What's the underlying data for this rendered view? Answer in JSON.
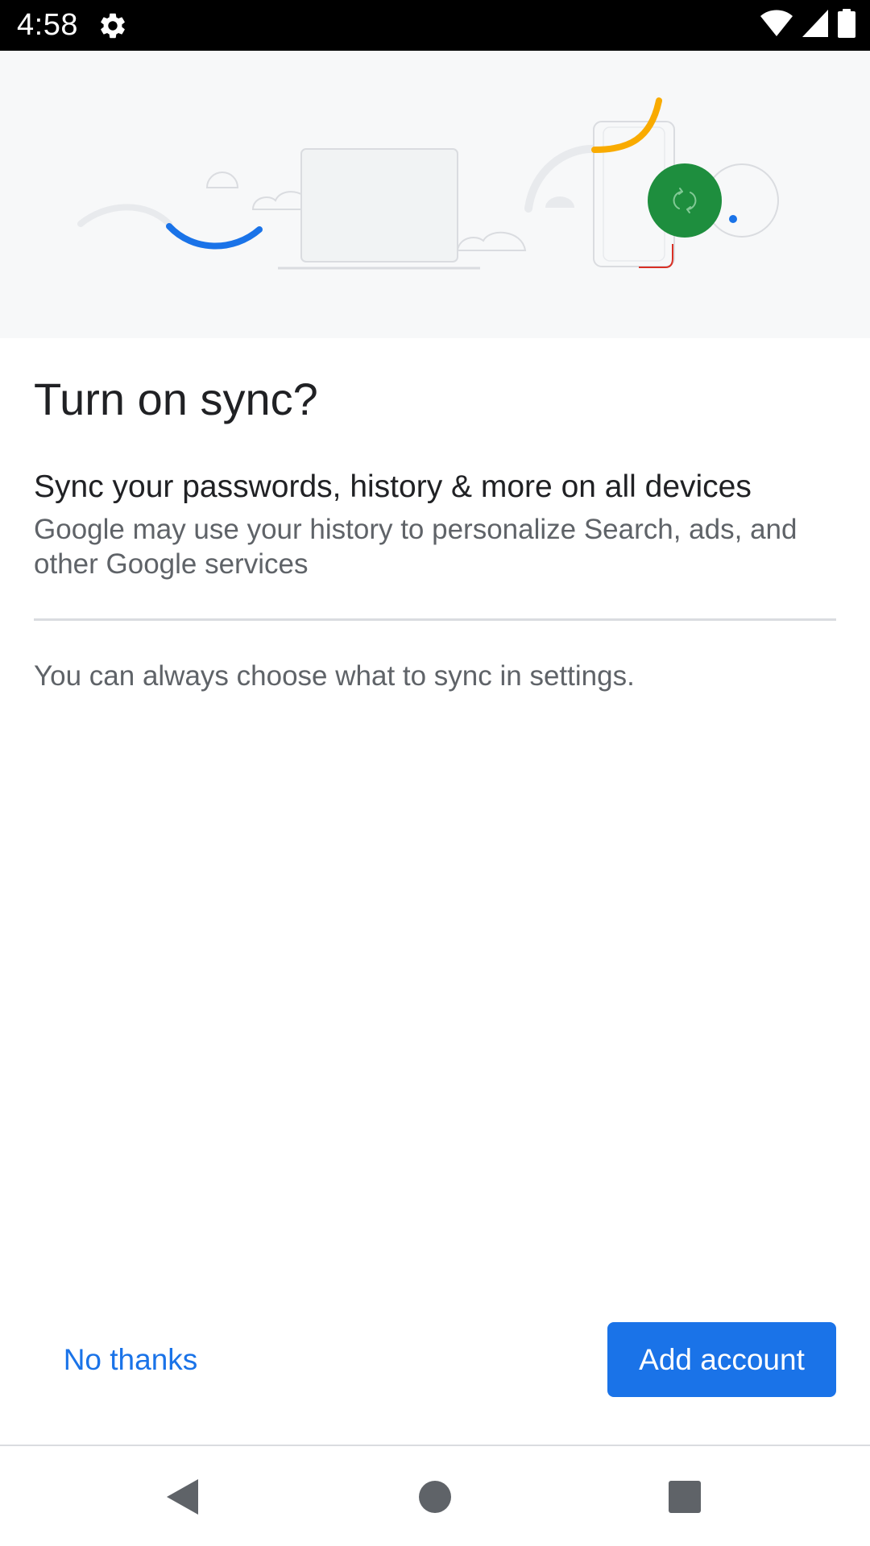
{
  "status_bar": {
    "time": "4:58",
    "icons": [
      "settings-gear-icon",
      "wifi-icon",
      "cell-signal-icon",
      "battery-icon"
    ]
  },
  "hero": {
    "illustration": "sync-devices-illustration",
    "colors": {
      "background": "#f7f8f9",
      "blue_arc": "#1a73e8",
      "yellow_arc": "#f9ab00",
      "green_circle": "#1e8e3e",
      "red_accent": "#d93025",
      "outline": "#dadce0"
    }
  },
  "dialog": {
    "title": "Turn on sync?",
    "subtitle": "Sync your passwords, history & more on all devices",
    "description": "Google may use your history to personalize Search, ads, and other Google services",
    "settings_note": "You can always choose what to sync in settings."
  },
  "actions": {
    "no_thanks": "No thanks",
    "add_account": "Add account"
  },
  "nav_bar": {
    "icons": [
      "back-icon",
      "home-icon",
      "recents-icon"
    ]
  },
  "colors": {
    "accent": "#1a73e8",
    "text_primary": "#202124",
    "text_secondary": "#5f6368",
    "divider": "#dadce0"
  }
}
